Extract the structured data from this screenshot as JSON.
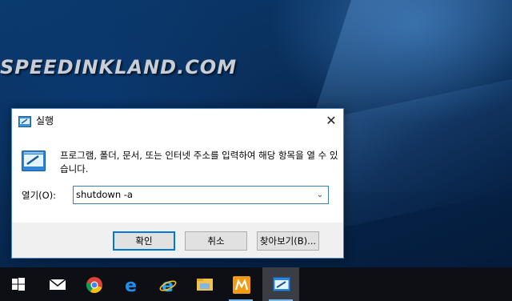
{
  "watermark": "SPEEDINKLAND.COM",
  "dialog": {
    "title": "실행",
    "close_icon": "close-icon",
    "description": "프로그램, 폴더, 문서, 또는 인터넷 주소를 입력하여 해당 항목을 열 수 있습니다.",
    "open_label": "열기(O):",
    "open_value": "shutdown -a",
    "buttons": {
      "ok": "확인",
      "cancel": "취소",
      "browse": "찾아보기(B)..."
    }
  },
  "taskbar": {
    "items": [
      {
        "name": "start-windows-icon"
      },
      {
        "name": "mail-icon"
      },
      {
        "name": "chrome-icon"
      },
      {
        "name": "edge-icon"
      },
      {
        "name": "internet-explorer-icon"
      },
      {
        "name": "file-explorer-icon"
      },
      {
        "name": "app-m-icon"
      },
      {
        "name": "run-dialog-icon",
        "active": true
      }
    ]
  },
  "colors": {
    "accent": "#0078d7",
    "dialog_border": "#4a89c8",
    "taskbar": "#0d0f14"
  }
}
